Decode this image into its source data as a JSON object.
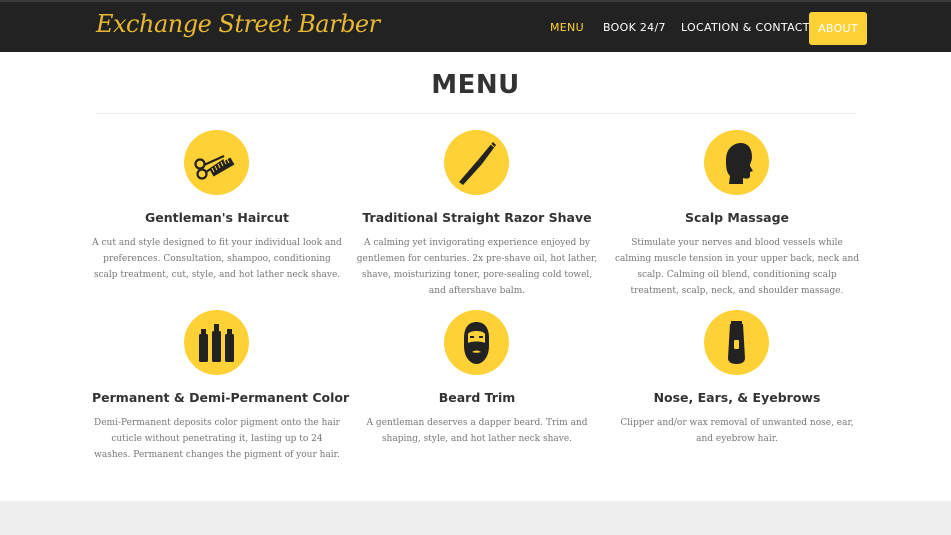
{
  "brand": {
    "logo_text": "Exchange Street Barber",
    "accent": "#fed136",
    "nav_bg": "#222222"
  },
  "nav": {
    "items": [
      {
        "label": "MENU",
        "active": true
      },
      {
        "label": "BOOK 24/7",
        "active": false
      },
      {
        "label": "LOCATION & CONTACT",
        "active": false
      },
      {
        "label": "ABOUT",
        "active": false
      }
    ]
  },
  "section": {
    "title": "MENU"
  },
  "services": [
    {
      "icon": "scissors-comb-icon",
      "title": "Gentleman's Haircut",
      "description": "A cut and style designed to fit your individual look and preferences. Consultation, shampoo, conditioning scalp treatment, cut, style, and hot lather neck shave."
    },
    {
      "icon": "straight-razor-icon",
      "title": "Traditional Straight Razor Shave",
      "description": "A calming yet invigorating experience enjoyed by gentlemen for centuries. 2x pre-shave oil, hot lather, shave, moisturizing toner, pore-sealing cold towel, and aftershave balm."
    },
    {
      "icon": "head-profile-icon",
      "title": "Scalp Massage",
      "description": "Stimulate your nerves and blood vessels while calming muscle tension in your upper back, neck and scalp. Calming oil blend, conditioning scalp treatment, scalp, neck, and shoulder massage."
    },
    {
      "icon": "dye-bottles-icon",
      "title": "Permanent & Demi-Permanent Color",
      "description": "Demi-Permanent deposits color pigment onto the hair cuticle without penetrating it, lasting up to 24 washes. Permanent changes the pigment of your hair."
    },
    {
      "icon": "bearded-face-icon",
      "title": "Beard Trim",
      "description": "A gentleman deserves a dapper beard. Trim and shaping, style, and hot lather neck shave."
    },
    {
      "icon": "trimmer-icon",
      "title": "Nose, Ears, & Eyebrows",
      "description": "Clipper and/or wax removal of unwanted nose, ear, and eyebrow hair."
    }
  ]
}
